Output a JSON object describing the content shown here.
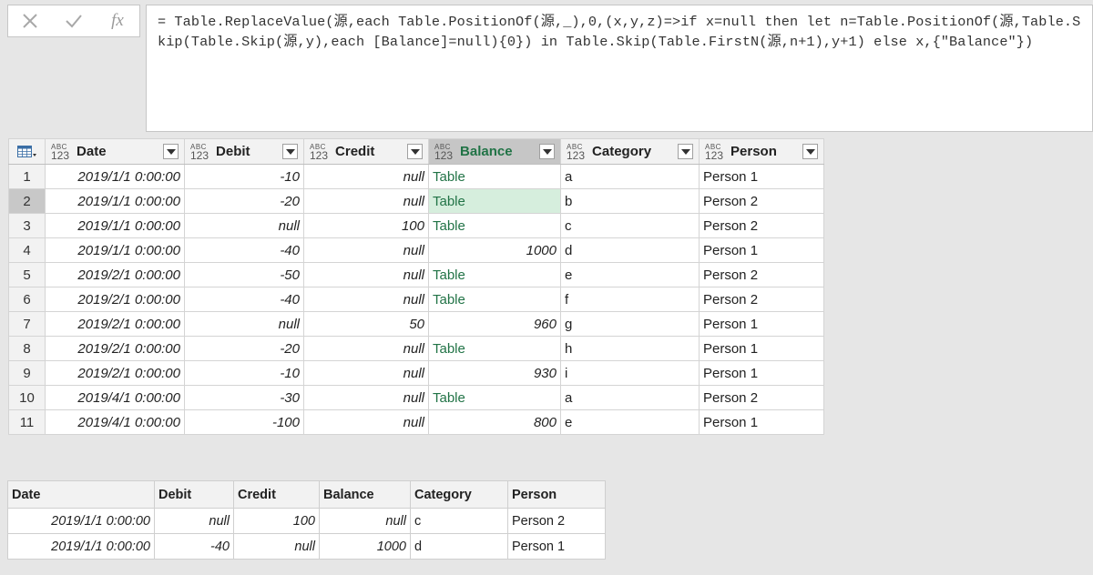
{
  "formula_bar": {
    "cancel_icon": "x-icon",
    "enter_icon": "check-icon",
    "fx_label": "fx",
    "formula": "= Table.ReplaceValue(源,each Table.PositionOf(源,_),0,(x,y,z)=>if x=null then let n=Table.PositionOf(源,Table.Skip(Table.Skip(源,y),each [Balance]=null){0}) in Table.Skip(Table.FirstN(源,n+1),y+1) else x,{\"Balance\"})"
  },
  "grid": {
    "type_label_top": "ABC",
    "type_label_bottom": "123",
    "columns": [
      {
        "name": "Date"
      },
      {
        "name": "Debit"
      },
      {
        "name": "Credit"
      },
      {
        "name": "Balance",
        "active": true
      },
      {
        "name": "Category"
      },
      {
        "name": "Person"
      }
    ],
    "rows": [
      {
        "n": "1",
        "date": "2019/1/1 0:00:00",
        "debit": "-10",
        "credit": "null",
        "balance": "Table",
        "category": "a",
        "person": "Person 1"
      },
      {
        "n": "2",
        "date": "2019/1/1 0:00:00",
        "debit": "-20",
        "credit": "null",
        "balance": "Table",
        "category": "b",
        "person": "Person 2"
      },
      {
        "n": "3",
        "date": "2019/1/1 0:00:00",
        "debit": "null",
        "credit": "100",
        "balance": "Table",
        "category": "c",
        "person": "Person 2"
      },
      {
        "n": "4",
        "date": "2019/1/1 0:00:00",
        "debit": "-40",
        "credit": "null",
        "balance": "1000",
        "category": "d",
        "person": "Person 1"
      },
      {
        "n": "5",
        "date": "2019/2/1 0:00:00",
        "debit": "-50",
        "credit": "null",
        "balance": "Table",
        "category": "e",
        "person": "Person 2"
      },
      {
        "n": "6",
        "date": "2019/2/1 0:00:00",
        "debit": "-40",
        "credit": "null",
        "balance": "Table",
        "category": "f",
        "person": "Person 2"
      },
      {
        "n": "7",
        "date": "2019/2/1 0:00:00",
        "debit": "null",
        "credit": "50",
        "balance": "960",
        "category": "g",
        "person": "Person 1"
      },
      {
        "n": "8",
        "date": "2019/2/1 0:00:00",
        "debit": "-20",
        "credit": "null",
        "balance": "Table",
        "category": "h",
        "person": "Person 1"
      },
      {
        "n": "9",
        "date": "2019/2/1 0:00:00",
        "debit": "-10",
        "credit": "null",
        "balance": "930",
        "category": "i",
        "person": "Person 1"
      },
      {
        "n": "10",
        "date": "2019/4/1 0:00:00",
        "debit": "-30",
        "credit": "null",
        "balance": "Table",
        "category": "a",
        "person": "Person 2"
      },
      {
        "n": "11",
        "date": "2019/4/1 0:00:00",
        "debit": "-100",
        "credit": "null",
        "balance": "800",
        "category": "e",
        "person": "Person 1"
      }
    ],
    "selected_row": "2",
    "table_link_color": "#217346",
    "selected_cell_color": "#d6eedd"
  },
  "preview": {
    "columns": [
      "Date",
      "Debit",
      "Credit",
      "Balance",
      "Category",
      "Person"
    ],
    "rows": [
      {
        "date": "2019/1/1 0:00:00",
        "debit": "null",
        "credit": "100",
        "balance": "null",
        "category": "c",
        "person": "Person 2"
      },
      {
        "date": "2019/1/1 0:00:00",
        "debit": "-40",
        "credit": "null",
        "balance": "1000",
        "category": "d",
        "person": "Person 1"
      }
    ]
  }
}
